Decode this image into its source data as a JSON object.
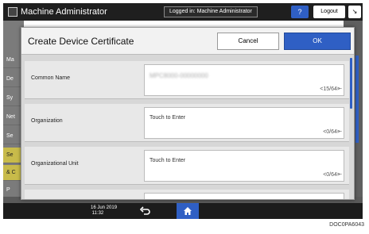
{
  "topbar": {
    "title": "Machine Administrator",
    "login_status": "Logged in: Machine Administrator",
    "help_label": "?",
    "logout_label": "Logout",
    "extra_label": "↘"
  },
  "background_sidebar": {
    "items": [
      "Ma",
      "De",
      "Sy",
      "Net",
      "Se",
      "Se",
      "& C",
      "P"
    ]
  },
  "dialog": {
    "title": "Create Device Certificate",
    "cancel_label": "Cancel",
    "ok_label": "OK",
    "fields": [
      {
        "label": "Common Name",
        "value": "MPC8000-00000000",
        "count": "<15/64>"
      },
      {
        "label": "Organization",
        "value": "Touch to Enter",
        "count": "<0/64>"
      },
      {
        "label": "Organizational Unit",
        "value": "Touch to Enter",
        "count": "<0/64>"
      }
    ]
  },
  "bottombar": {
    "datetime": "16 Jun 2019\n 11:32"
  },
  "footer_code": "DOC0PA6043",
  "colors": {
    "accent_blue": "#2f5fc4",
    "topbar": "#1f1f1f",
    "dialog_bg": "#d7d7d7"
  }
}
